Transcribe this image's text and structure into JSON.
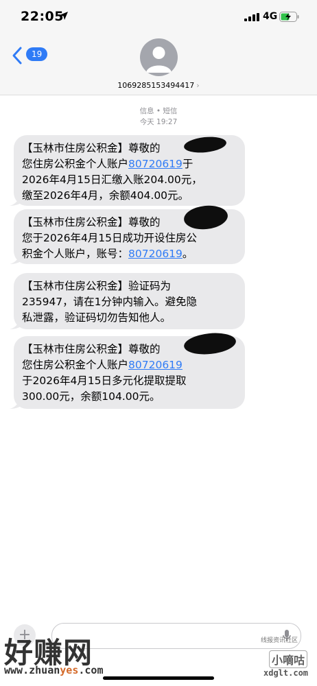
{
  "status_bar": {
    "time": "22:05",
    "network": "4G"
  },
  "nav": {
    "unread_badge": "19",
    "sender_number": "1069285153494417",
    "sender_chevron": "›"
  },
  "thread": {
    "service_label": "信息 • 短信",
    "timestamp": "今天 19:27"
  },
  "messages": [
    {
      "lines": [
        "【玉林市住房公积金】尊敬的",
        "您住房公积金个人账户",
        "于",
        "2026年4月15日汇缴入账204.00元，",
        "缴至2026年4月，余额404.00元。"
      ],
      "account": "80720619"
    },
    {
      "lines": [
        "【玉林市住房公积金】尊敬的",
        "您于2026年4月15日成功开设住房公",
        "积金个人账户，账号：",
        "。"
      ],
      "account": "80720619"
    },
    {
      "lines": [
        "【玉林市住房公积金】验证码为",
        "235947，请在1分钟内输入。避免隐",
        "私泄露，验证码切勿告知他人。"
      ]
    },
    {
      "lines": [
        "【玉林市住房公积金】尊敬的",
        "您住房公积金个人账户",
        "",
        "于2026年4月15日多元化提取提取",
        "300.00元，余额104.00元。"
      ],
      "account": "80720619"
    }
  ],
  "icons": {
    "back": "chevron-left-icon",
    "avatar": "person-icon",
    "location": "location-arrow-icon",
    "signal": "signal-icon",
    "battery": "battery-charging-icon",
    "plus": "plus-icon",
    "mic": "microphone-icon"
  },
  "colors": {
    "link": "#2f7bf6",
    "bubble": "#e9e9eb",
    "badge": "#2f7bf6"
  },
  "watermarks": {
    "left_logo": "好赚网",
    "left_url_a": "www.zhuan",
    "left_url_b": "yes",
    "left_url_c": ".com",
    "right_logo_top": "线报资讯社区",
    "right_logo": "小嘀咕",
    "right_url": "xdglt.com"
  },
  "input": {
    "plus_label": "+"
  }
}
